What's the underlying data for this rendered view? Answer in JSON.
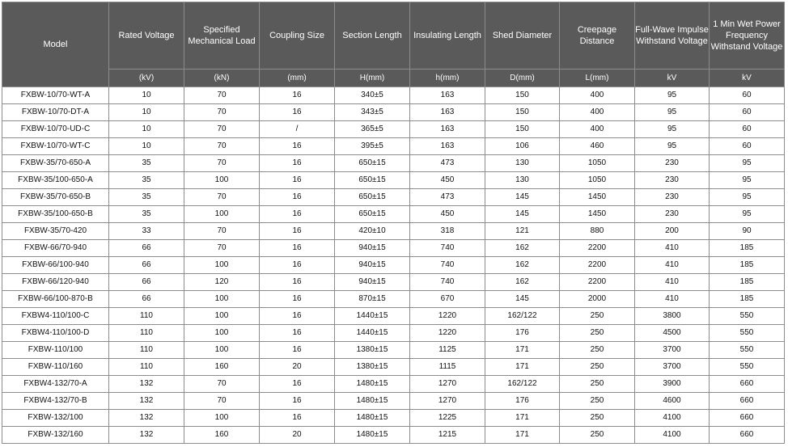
{
  "table": {
    "columns": [
      {
        "key": "model",
        "label": "Model",
        "unit": ""
      },
      {
        "key": "rated_voltage",
        "label": "Rated Voltage",
        "unit": "(kV)"
      },
      {
        "key": "mech_load",
        "label": "Specified Mechanical Load",
        "unit": "(kN)"
      },
      {
        "key": "coupling",
        "label": "Coupling Size",
        "unit": "(mm)"
      },
      {
        "key": "section",
        "label": "Section Length",
        "unit": "H(mm)"
      },
      {
        "key": "insulating",
        "label": "Insulating Length",
        "unit": "h(mm)"
      },
      {
        "key": "shed",
        "label": "Shed Diameter",
        "unit": "D(mm)"
      },
      {
        "key": "creepage",
        "label": "Creepage Distance",
        "unit": "L(mm)"
      },
      {
        "key": "impulse",
        "label": "Full-Wave Impulse Withstand Voltage",
        "unit": "kV"
      },
      {
        "key": "wet_power",
        "label": "1 Min Wet Power Frequency Withstand Voltage",
        "unit": "kV"
      }
    ],
    "rows": [
      [
        "FXBW-10/70-WT-A",
        "10",
        "70",
        "16",
        "340±5",
        "163",
        "150",
        "400",
        "95",
        "60"
      ],
      [
        "FXBW-10/70-DT-A",
        "10",
        "70",
        "16",
        "343±5",
        "163",
        "150",
        "400",
        "95",
        "60"
      ],
      [
        "FXBW-10/70-UD-C",
        "10",
        "70",
        "/",
        "365±5",
        "163",
        "150",
        "400",
        "95",
        "60"
      ],
      [
        "FXBW-10/70-WT-C",
        "10",
        "70",
        "16",
        "395±5",
        "163",
        "106",
        "460",
        "95",
        "60"
      ],
      [
        "FXBW-35/70-650-A",
        "35",
        "70",
        "16",
        "650±15",
        "473",
        "130",
        "1050",
        "230",
        "95"
      ],
      [
        "FXBW-35/100-650-A",
        "35",
        "100",
        "16",
        "650±15",
        "450",
        "130",
        "1050",
        "230",
        "95"
      ],
      [
        "FXBW-35/70-650-B",
        "35",
        "70",
        "16",
        "650±15",
        "473",
        "145",
        "1450",
        "230",
        "95"
      ],
      [
        "FXBW-35/100-650-B",
        "35",
        "100",
        "16",
        "650±15",
        "450",
        "145",
        "1450",
        "230",
        "95"
      ],
      [
        "FXBW-35/70-420",
        "33",
        "70",
        "16",
        "420±10",
        "318",
        "121",
        "880",
        "200",
        "90"
      ],
      [
        "FXBW-66/70-940",
        "66",
        "70",
        "16",
        "940±15",
        "740",
        "162",
        "2200",
        "410",
        "185"
      ],
      [
        "FXBW-66/100-940",
        "66",
        "100",
        "16",
        "940±15",
        "740",
        "162",
        "2200",
        "410",
        "185"
      ],
      [
        "FXBW-66/120-940",
        "66",
        "120",
        "16",
        "940±15",
        "740",
        "162",
        "2200",
        "410",
        "185"
      ],
      [
        "FXBW-66/100-870-B",
        "66",
        "100",
        "16",
        "870±15",
        "670",
        "145",
        "2000",
        "410",
        "185"
      ],
      [
        "FXBW4-110/100-C",
        "110",
        "100",
        "16",
        "1440±15",
        "1220",
        "162/122",
        "250",
        "3800",
        "550"
      ],
      [
        "FXBW4-110/100-D",
        "110",
        "100",
        "16",
        "1440±15",
        "1220",
        "176",
        "250",
        "4500",
        "550"
      ],
      [
        "FXBW-110/100",
        "110",
        "100",
        "16",
        "1380±15",
        "1125",
        "171",
        "250",
        "3700",
        "550"
      ],
      [
        "FXBW-110/160",
        "110",
        "160",
        "20",
        "1380±15",
        "1115",
        "171",
        "250",
        "3700",
        "550"
      ],
      [
        "FXBW4-132/70-A",
        "132",
        "70",
        "16",
        "1480±15",
        "1270",
        "162/122",
        "250",
        "3900",
        "660"
      ],
      [
        "FXBW4-132/70-B",
        "132",
        "70",
        "16",
        "1480±15",
        "1270",
        "176",
        "250",
        "4600",
        "660"
      ],
      [
        "FXBW-132/100",
        "132",
        "100",
        "16",
        "1480±15",
        "1225",
        "171",
        "250",
        "4100",
        "660"
      ],
      [
        "FXBW-132/160",
        "132",
        "160",
        "20",
        "1480±15",
        "1215",
        "171",
        "250",
        "4100",
        "660"
      ]
    ]
  },
  "colors": {
    "header_bg": "#5a5a5a",
    "header_text": "#ffffff",
    "grid": "#8c8c8c"
  }
}
